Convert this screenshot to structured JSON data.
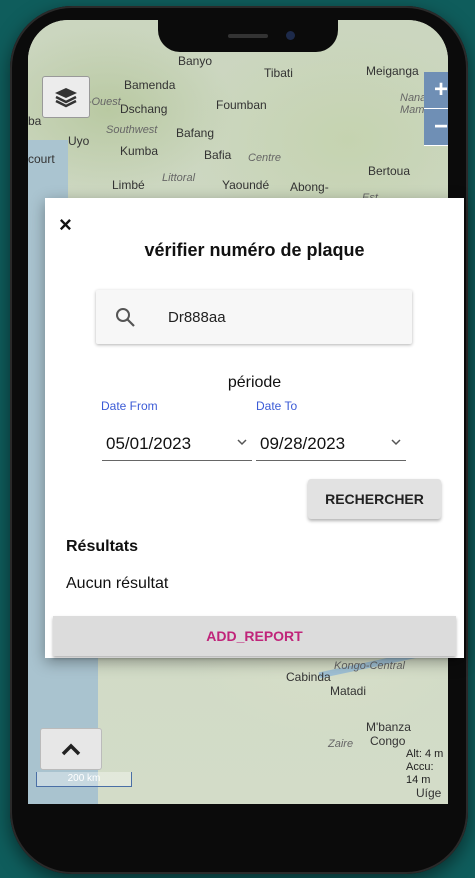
{
  "map": {
    "places": [
      "Banyo",
      "Tibati",
      "Meiganga",
      "Bamenda",
      "Nord-Ouest",
      "Dschang",
      "Foumban",
      "Uyo",
      "Southwest",
      "Bafang",
      "Kumba",
      "Bafia",
      "Centre",
      "Limbé",
      "Littoral",
      "Yaoundé",
      "Abong-",
      "Bertoua",
      "Nana-Mam",
      "Est",
      "Kongo-Central",
      "Cabinda",
      "Matadi",
      "M'banza",
      "Congo",
      "Zaire",
      "Uíge",
      "court",
      "ba"
    ],
    "zoom_in": "+",
    "zoom_out": "−",
    "scale_label": "200 km",
    "alt": "Alt: 4 m",
    "accu": "Accu: 14 m"
  },
  "modal": {
    "close": "×",
    "title": "vérifier numéro de plaque",
    "search_value": "Dr888aa",
    "periode_label": "période",
    "date_from_label": "Date From",
    "date_to_label": "Date To",
    "date_from": "05/01/2023",
    "date_to": "09/28/2023",
    "search_button": "RECHERCHER",
    "results_title": "Résultats",
    "results_empty": "Aucun résultat",
    "add_report": "ADD_REPORT"
  },
  "icons": {
    "layers": "layers-icon",
    "search": "search-icon",
    "chevron": "chevron-down-icon",
    "up": "chevron-up-icon",
    "close": "close-icon"
  }
}
